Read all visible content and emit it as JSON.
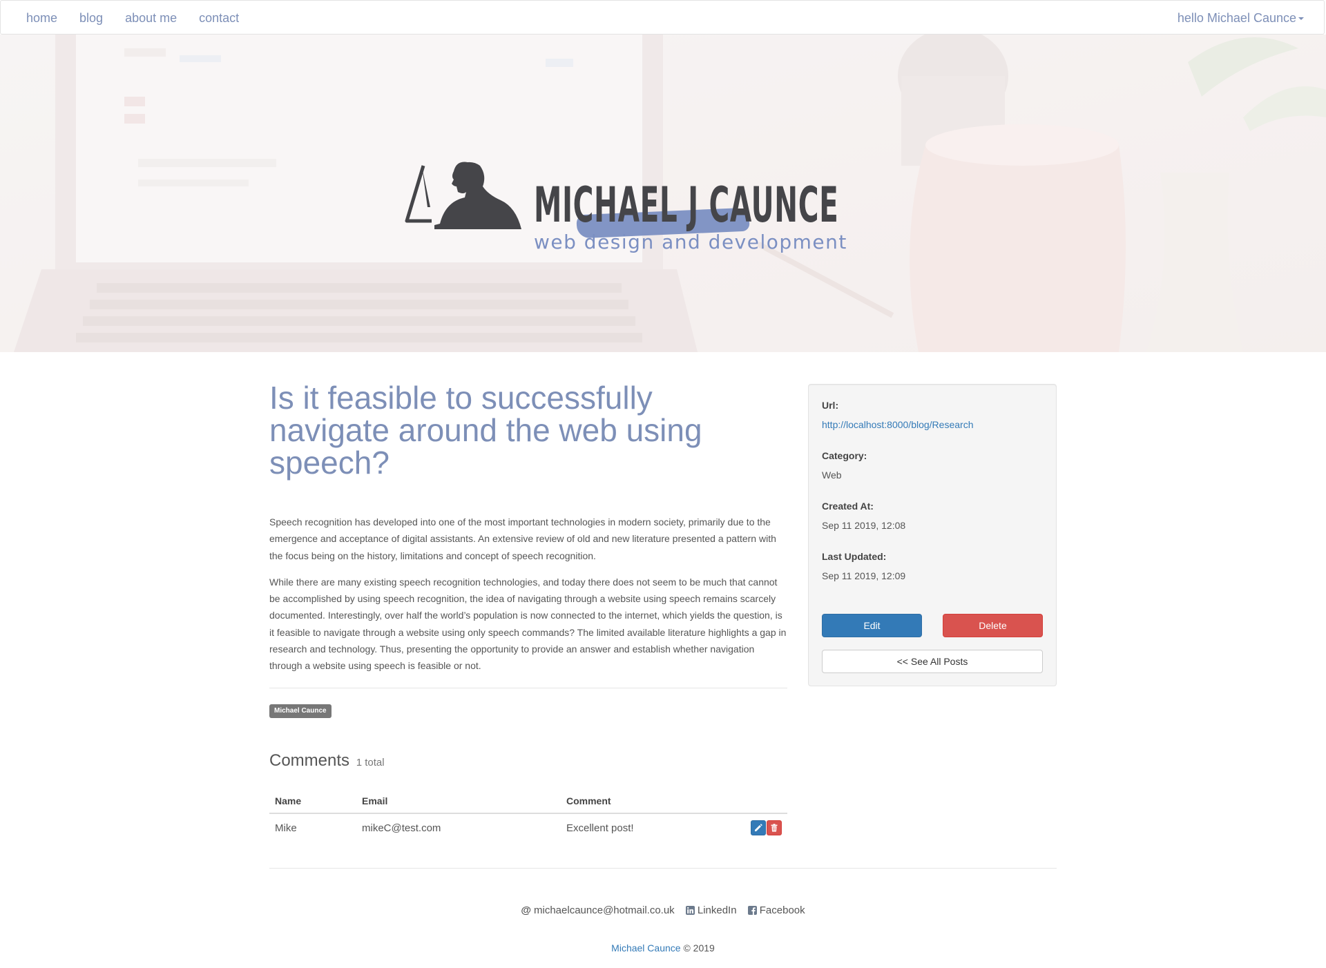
{
  "navbar": {
    "links": [
      "home",
      "blog",
      "about me",
      "contact"
    ],
    "user_greeting": "hello Michael Caunce"
  },
  "hero": {
    "logo_title": "MICHAEL J CAUNCE",
    "logo_subtitle": "web design and development",
    "accent_color": "#7b8fc2"
  },
  "post": {
    "title": "Is it feasible to successfully navigate around the web using speech?",
    "paragraphs": [
      "Speech recognition has developed into one of the most important technologies in modern society, primarily due to the emergence and acceptance of digital assistants. An extensive review of old and new literature presented a pattern with the focus being on the history, limitations and concept of speech recognition.",
      "While there are many existing speech recognition technologies, and today there does not seem to be much that cannot be accomplished by using speech recognition, the idea of navigating through a website using speech remains scarcely documented. Interestingly, over half the world’s population is now connected to the internet, which yields the question, is it feasible to navigate through a website using only speech commands? The limited available literature highlights a gap in research and technology. Thus, presenting the opportunity to provide an answer and establish whether navigation through a website using speech is feasible or not."
    ],
    "author_tag": "Michael Caunce"
  },
  "comments": {
    "title": "Comments",
    "count_text": "1 total",
    "headers": [
      "Name",
      "Email",
      "Comment"
    ],
    "rows": [
      {
        "name": "Mike",
        "email": "mikeC@test.com",
        "comment": "Excellent post!"
      }
    ]
  },
  "sidebar": {
    "url_label": "Url:",
    "url_value": "http://localhost:8000/blog/Research",
    "category_label": "Category:",
    "category_value": "Web",
    "created_label": "Created At:",
    "created_value": "Sep 11 2019, 12:08",
    "updated_label": "Last Updated:",
    "updated_value": "Sep 11 2019, 12:09",
    "edit_label": "Edit",
    "delete_label": "Delete",
    "all_posts_label": "<< See All Posts"
  },
  "footer": {
    "email": "michaelcaunce@hotmail.co.uk",
    "linkedin": "LinkedIn",
    "facebook": "Facebook",
    "copyright_name": "Michael Caunce",
    "copyright_year": "© 2019"
  },
  "colors": {
    "nav_link": "#7d8fb7",
    "primary": "#337ab7",
    "danger": "#d9534f"
  }
}
